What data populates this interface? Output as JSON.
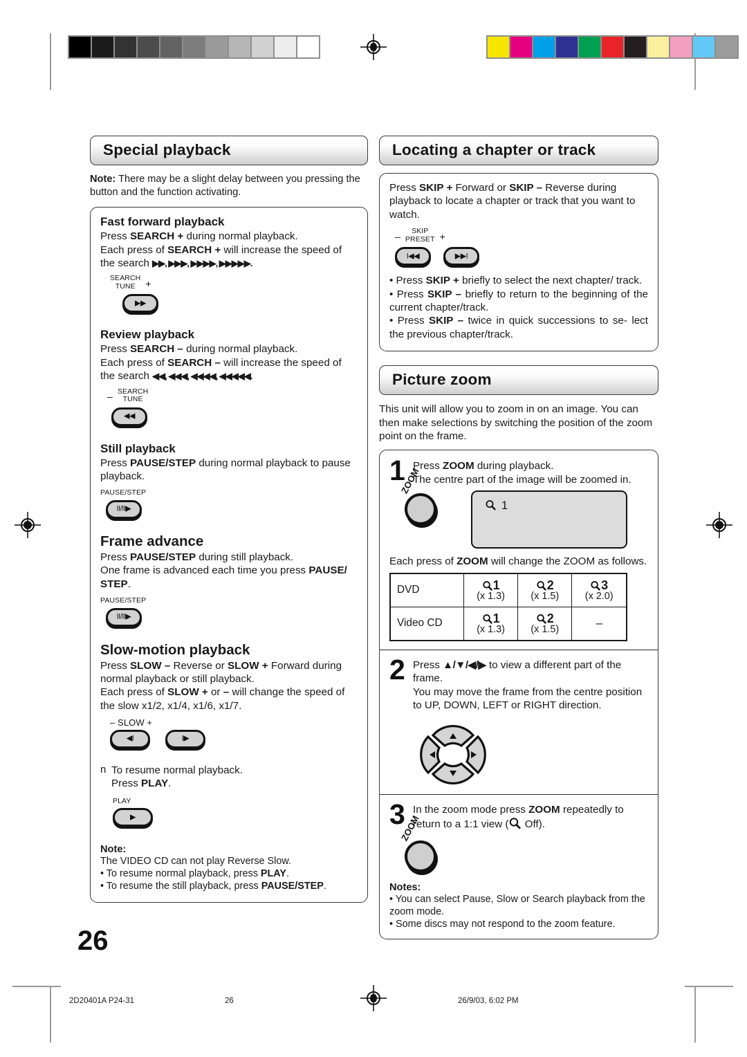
{
  "page": {
    "number": "26",
    "footer": {
      "doc_id": "2D20401A P24-31",
      "page_label": "26",
      "timestamp": "26/9/03, 6:02 PM"
    }
  },
  "calibration": {
    "gray_swatches": [
      "#000000",
      "#1b1b1b",
      "#333333",
      "#4c4c4c",
      "#636363",
      "#7c7c7c",
      "#9a9a9a",
      "#b6b6b6",
      "#d2d2d2",
      "#ededed",
      "#ffffff"
    ],
    "color_swatches": [
      "#f5e500",
      "#e5007e",
      "#00a0e9",
      "#2e3192",
      "#00a051",
      "#e8242a",
      "#231f20",
      "#fbf0a0",
      "#f3a0c0",
      "#62c8f5",
      "#9b9b9b"
    ]
  },
  "left_column": {
    "section_title": "Special playback",
    "note_label": "Note:",
    "note_text": " There may be a slight delay between you pressing the button and the function activating.",
    "blocks": [
      {
        "heading": "Fast forward playback",
        "line1_a": "Press ",
        "line1_b": "SEARCH +",
        "line1_c": " during normal playback.",
        "line2_a": "Each press of ",
        "line2_b": "SEARCH +",
        "line2_c": " will increase the speed of the search ",
        "arrows": "▶▶, ▶▶▶, ▶▶▶▶, ▶▶▶▶▶.",
        "key_label_top": "SEARCH",
        "key_label_bottom": "TUNE",
        "key_sign": "+",
        "key_glyph": "▶▶"
      },
      {
        "heading": "Review playback",
        "line1_a": "Press ",
        "line1_b": "SEARCH –",
        "line1_c": " during normal playback.",
        "line2_a": "Each press of ",
        "line2_b": "SEARCH –",
        "line2_c": "  will increase the speed of the search ",
        "arrows": "◀◀, ◀◀◀, ◀◀◀◀, ◀◀◀◀◀.",
        "key_label_top": "SEARCH",
        "key_label_bottom": "TUNE",
        "key_sign": "–",
        "key_glyph": "◀◀"
      },
      {
        "heading": "Still playback",
        "line1_a": "Press ",
        "line1_b": "PAUSE/STEP",
        "line1_c": " during normal playback to pause playback.",
        "key_label_top": "PAUSE/STEP",
        "key_glyph": "II/II▶"
      },
      {
        "heading": "Frame advance",
        "line1_a": "Press ",
        "line1_b": "PAUSE/STEP",
        "line1_c": " during still playback.",
        "line2_a": "One frame is advanced each time you press ",
        "line2_b": "PAUSE/ STEP",
        "line2_c": ".",
        "key_label_top": "PAUSE/STEP",
        "key_glyph": "II/II▶"
      },
      {
        "heading": "Slow-motion playback",
        "line1_a": "Press ",
        "line1_b": "SLOW –",
        "line1_c": " Reverse or ",
        "line1_d": "SLOW +",
        "line1_e": " Forward during normal playback or still playback.",
        "line2_a": "Each press of ",
        "line2_b": "SLOW +",
        "line2_c": " or ",
        "line2_d": "–",
        "line2_e": " will change the speed of the slow x1/2, x1/4, x1/6, x1/7.",
        "key_label": "–  SLOW  +",
        "key_glyph_minus": "◀I",
        "key_glyph_plus": "I▶"
      }
    ],
    "resume": {
      "bullet": "n",
      "line1": "To resume normal playback.",
      "line2_a": "Press ",
      "line2_b": "PLAY",
      "line2_c": ".",
      "key_label_top": "PLAY",
      "key_glyph": "▶"
    },
    "note_block": {
      "title": "Note:",
      "line1": "The VIDEO CD can not play Reverse Slow.",
      "line2_a": "• To resume normal playback, press ",
      "line2_b": "PLAY",
      "line2_c": ".",
      "line3_a": "• To resume the still playback, press ",
      "line3_b": "PAUSE/STEP",
      "line3_c": "."
    }
  },
  "right_column": {
    "locating": {
      "section_title": "Locating a chapter or track",
      "intro_a": "Press ",
      "intro_b": "SKIP +",
      "intro_c": " Forward or ",
      "intro_d": "SKIP –",
      "intro_e": " Reverse during playback to locate a chapter or track that you want to watch.",
      "key_label_top": "SKIP",
      "key_label_bottom": "PRESET",
      "key_sign_left": "–",
      "key_sign_right": "+",
      "key_glyph_prev": "I◀◀",
      "key_glyph_next": "▶▶I",
      "bullets": [
        {
          "a": "• Press ",
          "b": "SKIP +",
          "c": " briefly to select the next chapter/ track."
        },
        {
          "a": "• Press ",
          "b": "SKIP –",
          "c": " briefly to return to the beginning of the current chapter/track."
        },
        {
          "a": "• Press ",
          "b": "SKIP –",
          "c": " twice in quick successions to se- lect the previous chapter/track."
        }
      ]
    },
    "picture_zoom": {
      "section_title": "Picture zoom",
      "intro": "This unit will allow you to zoom in on an image. You can then make selections by switching the position of the zoom point on the frame.",
      "step1": {
        "number": "1",
        "line1_a": "Press ",
        "line1_b": "ZOOM",
        "line1_c": " during playback.",
        "line2": "The centre part of the image will be zoomed in.",
        "dial_label": "ZOOM",
        "screen_indicator": "1",
        "after_a": "Each press of ",
        "after_b": "ZOOM",
        "after_c": " will change the ZOOM as follows."
      },
      "zoom_table": {
        "rows": [
          {
            "label": "DVD",
            "cells": [
              {
                "step": "1",
                "mult": "(x 1.3)"
              },
              {
                "step": "2",
                "mult": "(x 1.5)"
              },
              {
                "step": "3",
                "mult": "(x 2.0)"
              }
            ]
          },
          {
            "label": "Video CD",
            "cells": [
              {
                "step": "1",
                "mult": "(x 1.3)"
              },
              {
                "step": "2",
                "mult": "(x 1.5)"
              },
              {
                "step": "–",
                "mult": ""
              }
            ]
          }
        ]
      },
      "step2": {
        "number": "2",
        "line1_a": "Press ",
        "line1_b": "▲/▼/◀/▶",
        "line1_c": " to view a different part of the frame.",
        "line2": "You may move the frame from the centre position to  UP, DOWN, LEFT or RIGHT direction."
      },
      "step3": {
        "number": "3",
        "line_a": "In the zoom mode press ",
        "line_b": "ZOOM",
        "line_c": " repeatedly to return to a 1:1 view (",
        "line_d": " Off).",
        "dial_label": "ZOOM"
      },
      "notes": {
        "title": "Notes:",
        "items": [
          "• You can select Pause, Slow or Search playback from the zoom mode.",
          "• Some discs may not respond to the zoom feature."
        ]
      }
    }
  }
}
